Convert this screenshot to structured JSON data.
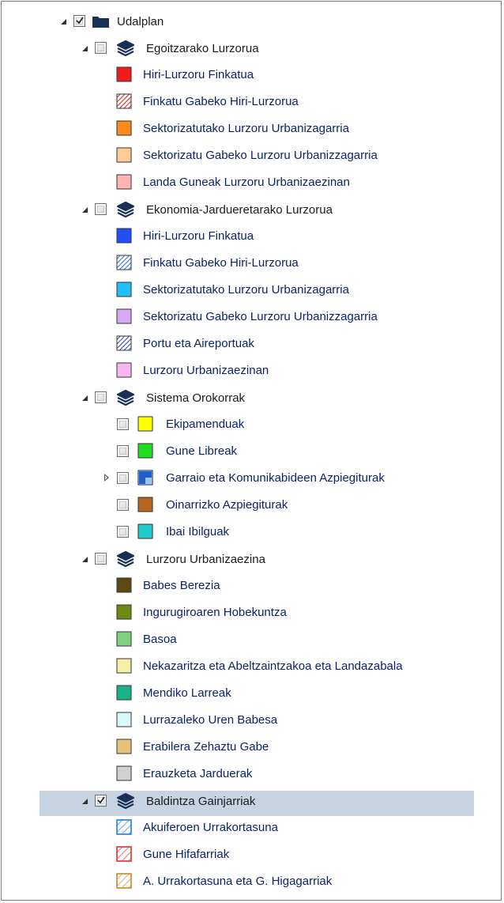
{
  "tree": {
    "root": {
      "label": "Udalplan",
      "checked": true,
      "expanded": true,
      "icon": "folder-icon"
    },
    "groups": [
      {
        "label": "Egoitzarako Lurzorua",
        "checked": false,
        "expanded": true,
        "icon": "layers-icon",
        "items": [
          {
            "label": "Hiri-Lurzoru Finkatua",
            "color": "#ee1c1c",
            "pattern": "solid"
          },
          {
            "label": "Finkatu Gabeko Hiri-Lurzorua",
            "color": "#ee1c1c",
            "pattern": "hatch"
          },
          {
            "label": "Sektorizatutako Lurzoru Urbanizagarria",
            "color": "#ff8a1e",
            "pattern": "solid"
          },
          {
            "label": "Sektorizatu Gabeko Lurzoru Urbanizzagarria",
            "color": "#ffcc99",
            "pattern": "solid"
          },
          {
            "label": "Landa Guneak Lurzoru Urbanizaezinan",
            "color": "#ffb3b3",
            "pattern": "solid"
          }
        ]
      },
      {
        "label": "Ekonomia-Jardueretarako Lurzorua",
        "checked": false,
        "expanded": true,
        "icon": "layers-icon",
        "items": [
          {
            "label": "Hiri-Lurzoru Finkatua",
            "color": "#1f4fff",
            "pattern": "solid"
          },
          {
            "label": "Finkatu Gabeko Hiri-Lurzorua",
            "color": "#2a6cff",
            "pattern": "hatch"
          },
          {
            "label": "Sektorizatutako Lurzoru Urbanizagarria",
            "color": "#1ec0f5",
            "pattern": "solid"
          },
          {
            "label": "Sektorizatu Gabeko Lurzoru Urbanizzagarria",
            "color": "#d6a9f2",
            "pattern": "solid"
          },
          {
            "label": "Portu eta Aireportuak",
            "color": "#2a3ce0",
            "pattern": "hatch"
          },
          {
            "label": "Lurzoru Urbanizaezinan",
            "color": "#f8b8ef",
            "pattern": "solid"
          }
        ]
      },
      {
        "label": "Sistema Orokorrak",
        "checked": false,
        "expanded": true,
        "icon": "layers-icon",
        "items": [
          {
            "label": "Ekipamenduak",
            "color": "#ffff00",
            "pattern": "solid",
            "checkbox": true
          },
          {
            "label": "Gune Libreak",
            "color": "#22dd22",
            "pattern": "solid",
            "checkbox": true
          },
          {
            "label": "Garraio eta Komunikabideen Azpiegiturak",
            "color": "#1f5fc8",
            "pattern": "grid",
            "checkbox": true,
            "expandable": true
          },
          {
            "label": "Oinarrizko Azpiegiturak",
            "color": "#b5651d",
            "pattern": "solid",
            "checkbox": true
          },
          {
            "label": "Ibai Ibilguak",
            "color": "#22c8c8",
            "pattern": "solid",
            "checkbox": true
          }
        ]
      },
      {
        "label": "Lurzoru Urbanizaezina",
        "checked": false,
        "expanded": true,
        "icon": "layers-icon",
        "items": [
          {
            "label": "Babes Berezia",
            "color": "#5b4a14",
            "pattern": "solid"
          },
          {
            "label": "Ingurugiroaren Hobekuntza",
            "color": "#6f8a14",
            "pattern": "solid"
          },
          {
            "label": "Basoa",
            "color": "#7fd17f",
            "pattern": "solid"
          },
          {
            "label": "Nekazaritza eta Abeltzaintzakoa eta Landazabala",
            "color": "#f4f0a8",
            "pattern": "solid"
          },
          {
            "label": "Mendiko Larreak",
            "color": "#1ab28c",
            "pattern": "solid"
          },
          {
            "label": "Lurrazaleko Uren Babesa",
            "color": "#d8f8fb",
            "pattern": "solid"
          },
          {
            "label": "Erabilera Zehaztu Gabe",
            "color": "#e8c27a",
            "pattern": "solid"
          },
          {
            "label": "Erauzketa Jarduerak",
            "color": "#d0d0d0",
            "pattern": "solid"
          }
        ]
      },
      {
        "label": "Baldintza Gainjarriak",
        "checked": true,
        "expanded": true,
        "selected": true,
        "icon": "layers-icon",
        "items": [
          {
            "label": "Akuiferoen Urrakortasuna",
            "color": "#1e7be6",
            "pattern": "hatch-outline"
          },
          {
            "label": "Gune Hifafarriak",
            "color": "#e03030",
            "pattern": "hatch-outline"
          },
          {
            "label": "A. Urrakortasuna eta G. Higagarriak",
            "color": "#c8862a",
            "pattern": "hatch-outline"
          }
        ]
      }
    ]
  }
}
